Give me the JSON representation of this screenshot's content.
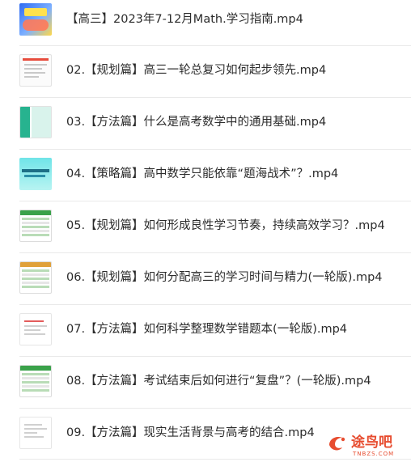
{
  "files": [
    {
      "label": "【高三】2023年7-12月Math.学习指南.mp4",
      "thumb": "cover-image"
    },
    {
      "label": "02.【规划篇】高三一轮总复习如何起步领先.mp4",
      "thumb": "document-image"
    },
    {
      "label": "03.【方法篇】什么是高考数学中的通用基础.mp4",
      "thumb": "slide-image"
    },
    {
      "label": "04.【策略篇】高中数学只能依靠“题海战术”？.mp4",
      "thumb": "slide-image"
    },
    {
      "label": "05.【规划篇】如何形成良性学习节奏，持续高效学习？.mp4",
      "thumb": "spreadsheet-image"
    },
    {
      "label": "06.【规划篇】如何分配高三的学习时间与精力(一轮版).mp4",
      "thumb": "spreadsheet-image"
    },
    {
      "label": "07.【方法篇】如何科学整理数学错题本(一轮版).mp4",
      "thumb": "document-image"
    },
    {
      "label": "08.【方法篇】考试结束后如何进行“复盘”？(一轮版).mp4",
      "thumb": "spreadsheet-image"
    },
    {
      "label": "09.【方法篇】现实生活背景与高考的结合.mp4",
      "thumb": "document-image"
    }
  ],
  "colors": {
    "text": "#2b2b2b",
    "separator": "#e9e9e9",
    "watermark": "#e74c2f"
  }
}
